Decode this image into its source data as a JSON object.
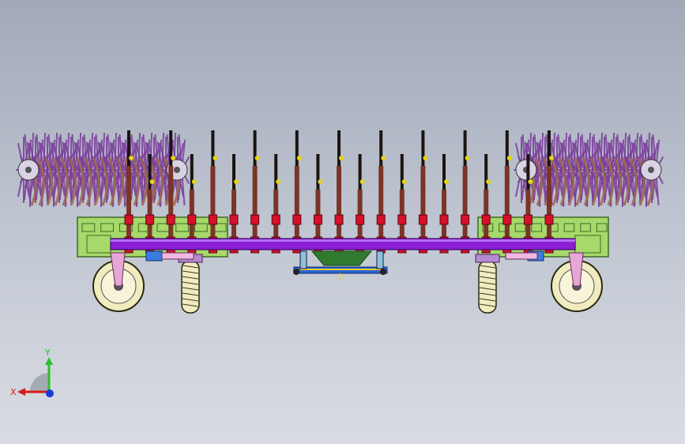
{
  "colors": {
    "background_top": "#a1a9b8",
    "background_bottom": "#d9dce2",
    "main_beam": "#8a1fd6",
    "frame": "#a6d86a",
    "clamp": "#d8102a",
    "shank": "#7a3528",
    "tine_tip": "#1a1410",
    "rotor": "#7a3e9b",
    "wheel_tire": "#f0ecc0",
    "hitch": "#2f7a2f",
    "axis_x": "#d81a1a",
    "axis_y": "#2bbf2b",
    "axis_z": "#1a3ad8"
  },
  "model": {
    "shank_count": 21,
    "rotor_count": 2,
    "wheel_count": 4
  },
  "triad": {
    "x_label": "X",
    "y_label": "Y"
  }
}
